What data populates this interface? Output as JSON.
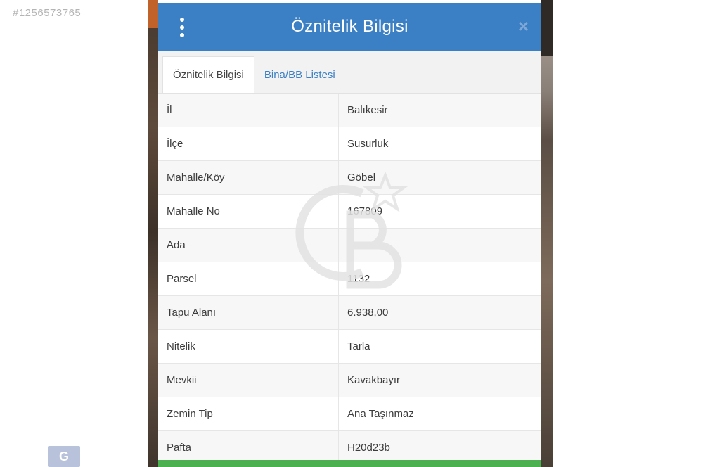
{
  "listing_id": "#1256573765",
  "dialog": {
    "title": "Öznitelik Bilgisi",
    "tabs": [
      {
        "label": "Öznitelik Bilgisi",
        "active": true
      },
      {
        "label": "Bina/BB Listesi",
        "active": false
      }
    ],
    "rows": [
      {
        "key": "İl",
        "value": "Balıkesir"
      },
      {
        "key": "İlçe",
        "value": "Susurluk"
      },
      {
        "key": "Mahalle/Köy",
        "value": "Göbel"
      },
      {
        "key": "Mahalle No",
        "value": "167809"
      },
      {
        "key": "Ada",
        "value": ""
      },
      {
        "key": "Parsel",
        "value": "1132"
      },
      {
        "key": "Tapu Alanı",
        "value": "6.938,00"
      },
      {
        "key": "Nitelik",
        "value": "Tarla"
      },
      {
        "key": "Mevkii",
        "value": "Kavakbayır"
      },
      {
        "key": "Zemin Tip",
        "value": "Ana Taşınmaz"
      },
      {
        "key": "Pafta",
        "value": "H20d23b"
      }
    ]
  },
  "icons": {
    "menu": "vertical-dots-icon",
    "close": "close-icon"
  },
  "colors": {
    "header": "#3b7fc4",
    "tab_link": "#3b7fc4",
    "footer_bar": "#4caf50"
  }
}
